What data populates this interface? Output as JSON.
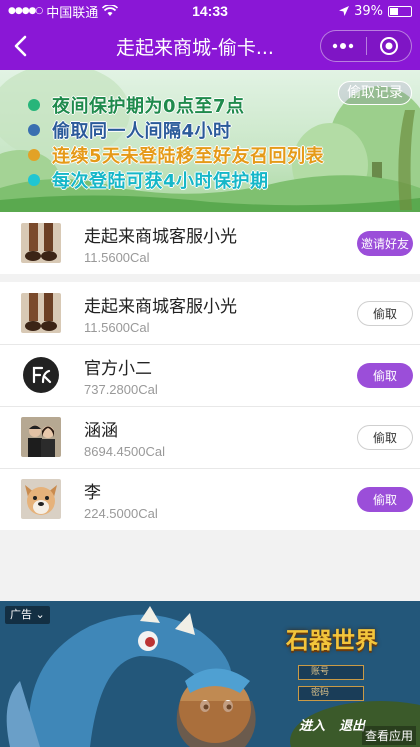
{
  "status_bar": {
    "carrier": "中国联通",
    "time": "14:33",
    "battery": "39%",
    "battery_level": 0.39
  },
  "nav": {
    "title": "走起来商城-偷卡..."
  },
  "banner": {
    "steal_log_label": "偷取记录",
    "rules": [
      {
        "text": "夜间保护期为0点至7点",
        "dot_color": "#27b57a",
        "text_color": "#1f8a4c"
      },
      {
        "text": "偷取同一人间隔4小时",
        "dot_color": "#3a6fb0",
        "text_color": "#2b5a9a"
      },
      {
        "text": "连续5天未登陆移至好友召回列表",
        "dot_color": "#e2a227",
        "text_color": "#e59a18"
      },
      {
        "text": "每次登陆可获4小时保护期",
        "dot_color": "#1fc6d2",
        "text_color": "#16b7c8"
      }
    ]
  },
  "self_row": {
    "name": "走起来商城客服小光",
    "score": "11.5600Cal",
    "button": "邀请好友"
  },
  "friends": [
    {
      "name": "走起来商城客服小光",
      "score": "11.5600Cal",
      "button": "偷取",
      "style": "outline",
      "avatar": "feet"
    },
    {
      "name": "官方小二",
      "score": "737.2800Cal",
      "button": "偷取",
      "style": "purple",
      "avatar": "logo"
    },
    {
      "name": "涵涵",
      "score": "8694.4500Cal",
      "button": "偷取",
      "style": "outline",
      "avatar": "couple"
    },
    {
      "name": "李",
      "score": "224.5000Cal",
      "button": "偷取",
      "style": "purple",
      "avatar": "dog"
    }
  ],
  "ad": {
    "tag": "广告",
    "game_title": "石器世界",
    "field_account": "账号",
    "field_password": "密码",
    "enter": "进入",
    "exit": "退出",
    "view_app": "查看应用"
  },
  "colors": {
    "brand": "#8a17d6",
    "button_purple": "#9b4ed9"
  }
}
